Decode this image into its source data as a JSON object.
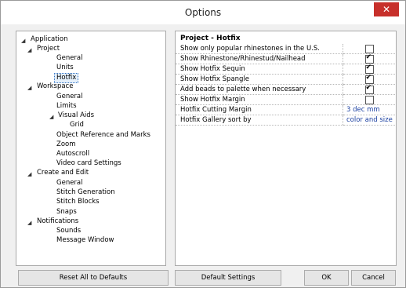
{
  "window": {
    "title": "Options",
    "close_label": "✕"
  },
  "tree": {
    "application": "Application",
    "project": "Project",
    "project_general": "General",
    "units": "Units",
    "hotfix": "Hotfix",
    "workspace": "Workspace",
    "workspace_general": "General",
    "limits": "Limits",
    "visual_aids": "Visual Aids",
    "grid": "Grid",
    "object_reference": "Object Reference and Marks",
    "zoom": "Zoom",
    "autoscroll": "Autoscroll",
    "video_card": "Video card Settings",
    "create_edit": "Create and Edit",
    "create_general": "General",
    "stitch_generation": "Stitch Generation",
    "stitch_blocks": "Stitch Blocks",
    "snaps": "Snaps",
    "notifications": "Notifications",
    "sounds": "Sounds",
    "message_window": "Message Window",
    "expander_glyph": "◢"
  },
  "grid": {
    "header": "Project - Hotfix",
    "rows": [
      {
        "label": "Show only popular rhinestones in the U.S.",
        "type": "checkbox",
        "checked": false
      },
      {
        "label": "Show Rhinestone/Rhinestud/Nailhead",
        "type": "checkbox",
        "checked": true
      },
      {
        "label": "Show Hotfix Sequin",
        "type": "checkbox",
        "checked": true
      },
      {
        "label": "Show Hotfix Spangle",
        "type": "checkbox",
        "checked": true
      },
      {
        "label": "Add beads to palette when necessary",
        "type": "checkbox",
        "checked": true
      },
      {
        "label": "Show Hotfix Margin",
        "type": "checkbox",
        "checked": false
      },
      {
        "label": "Hotfix Cutting Margin",
        "type": "text",
        "value": "3 dec mm"
      },
      {
        "label": "Hotfix Gallery sort by",
        "type": "text",
        "value": "color and size"
      }
    ]
  },
  "buttons": {
    "reset": "Reset All to Defaults",
    "default": "Default Settings",
    "ok": "OK",
    "cancel": "Cancel"
  }
}
